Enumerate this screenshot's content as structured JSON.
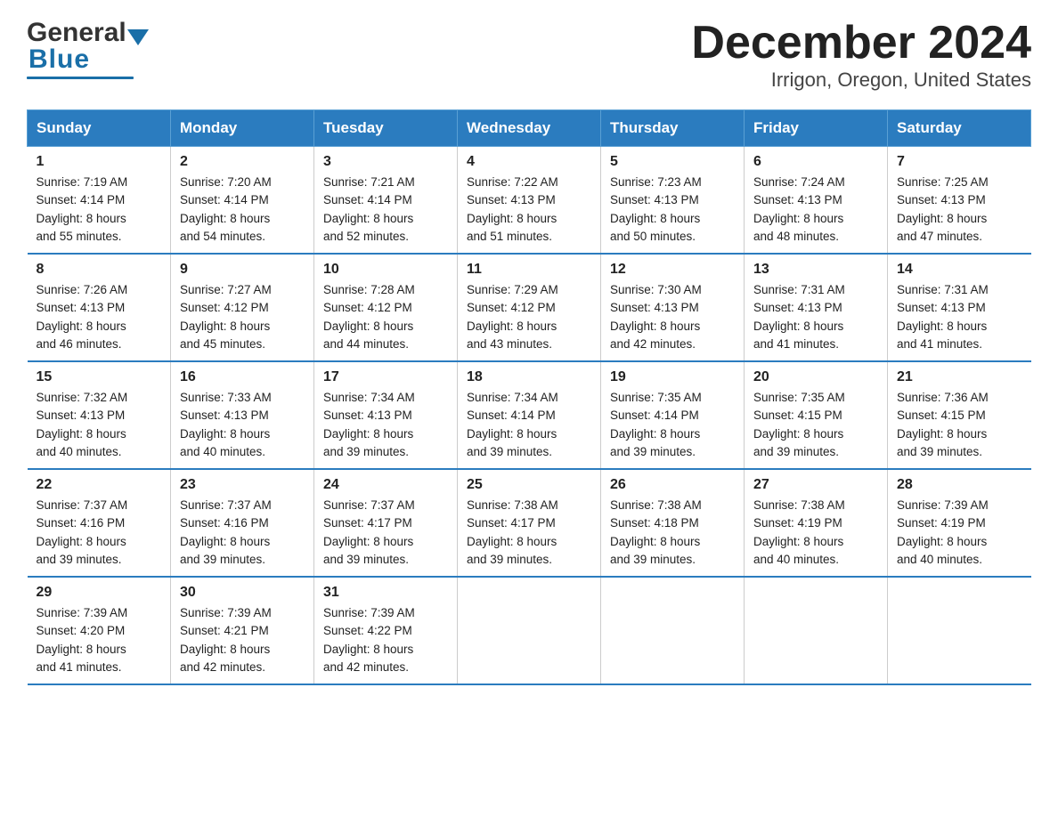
{
  "header": {
    "title": "December 2024",
    "subtitle": "Irrigon, Oregon, United States"
  },
  "logo": {
    "general": "General",
    "blue": "Blue"
  },
  "days_of_week": [
    "Sunday",
    "Monday",
    "Tuesday",
    "Wednesday",
    "Thursday",
    "Friday",
    "Saturday"
  ],
  "weeks": [
    [
      {
        "num": "1",
        "sunrise": "7:19 AM",
        "sunset": "4:14 PM",
        "daylight": "8 hours and 55 minutes."
      },
      {
        "num": "2",
        "sunrise": "7:20 AM",
        "sunset": "4:14 PM",
        "daylight": "8 hours and 54 minutes."
      },
      {
        "num": "3",
        "sunrise": "7:21 AM",
        "sunset": "4:14 PM",
        "daylight": "8 hours and 52 minutes."
      },
      {
        "num": "4",
        "sunrise": "7:22 AM",
        "sunset": "4:13 PM",
        "daylight": "8 hours and 51 minutes."
      },
      {
        "num": "5",
        "sunrise": "7:23 AM",
        "sunset": "4:13 PM",
        "daylight": "8 hours and 50 minutes."
      },
      {
        "num": "6",
        "sunrise": "7:24 AM",
        "sunset": "4:13 PM",
        "daylight": "8 hours and 48 minutes."
      },
      {
        "num": "7",
        "sunrise": "7:25 AM",
        "sunset": "4:13 PM",
        "daylight": "8 hours and 47 minutes."
      }
    ],
    [
      {
        "num": "8",
        "sunrise": "7:26 AM",
        "sunset": "4:13 PM",
        "daylight": "8 hours and 46 minutes."
      },
      {
        "num": "9",
        "sunrise": "7:27 AM",
        "sunset": "4:12 PM",
        "daylight": "8 hours and 45 minutes."
      },
      {
        "num": "10",
        "sunrise": "7:28 AM",
        "sunset": "4:12 PM",
        "daylight": "8 hours and 44 minutes."
      },
      {
        "num": "11",
        "sunrise": "7:29 AM",
        "sunset": "4:12 PM",
        "daylight": "8 hours and 43 minutes."
      },
      {
        "num": "12",
        "sunrise": "7:30 AM",
        "sunset": "4:13 PM",
        "daylight": "8 hours and 42 minutes."
      },
      {
        "num": "13",
        "sunrise": "7:31 AM",
        "sunset": "4:13 PM",
        "daylight": "8 hours and 41 minutes."
      },
      {
        "num": "14",
        "sunrise": "7:31 AM",
        "sunset": "4:13 PM",
        "daylight": "8 hours and 41 minutes."
      }
    ],
    [
      {
        "num": "15",
        "sunrise": "7:32 AM",
        "sunset": "4:13 PM",
        "daylight": "8 hours and 40 minutes."
      },
      {
        "num": "16",
        "sunrise": "7:33 AM",
        "sunset": "4:13 PM",
        "daylight": "8 hours and 40 minutes."
      },
      {
        "num": "17",
        "sunrise": "7:34 AM",
        "sunset": "4:13 PM",
        "daylight": "8 hours and 39 minutes."
      },
      {
        "num": "18",
        "sunrise": "7:34 AM",
        "sunset": "4:14 PM",
        "daylight": "8 hours and 39 minutes."
      },
      {
        "num": "19",
        "sunrise": "7:35 AM",
        "sunset": "4:14 PM",
        "daylight": "8 hours and 39 minutes."
      },
      {
        "num": "20",
        "sunrise": "7:35 AM",
        "sunset": "4:15 PM",
        "daylight": "8 hours and 39 minutes."
      },
      {
        "num": "21",
        "sunrise": "7:36 AM",
        "sunset": "4:15 PM",
        "daylight": "8 hours and 39 minutes."
      }
    ],
    [
      {
        "num": "22",
        "sunrise": "7:37 AM",
        "sunset": "4:16 PM",
        "daylight": "8 hours and 39 minutes."
      },
      {
        "num": "23",
        "sunrise": "7:37 AM",
        "sunset": "4:16 PM",
        "daylight": "8 hours and 39 minutes."
      },
      {
        "num": "24",
        "sunrise": "7:37 AM",
        "sunset": "4:17 PM",
        "daylight": "8 hours and 39 minutes."
      },
      {
        "num": "25",
        "sunrise": "7:38 AM",
        "sunset": "4:17 PM",
        "daylight": "8 hours and 39 minutes."
      },
      {
        "num": "26",
        "sunrise": "7:38 AM",
        "sunset": "4:18 PM",
        "daylight": "8 hours and 39 minutes."
      },
      {
        "num": "27",
        "sunrise": "7:38 AM",
        "sunset": "4:19 PM",
        "daylight": "8 hours and 40 minutes."
      },
      {
        "num": "28",
        "sunrise": "7:39 AM",
        "sunset": "4:19 PM",
        "daylight": "8 hours and 40 minutes."
      }
    ],
    [
      {
        "num": "29",
        "sunrise": "7:39 AM",
        "sunset": "4:20 PM",
        "daylight": "8 hours and 41 minutes."
      },
      {
        "num": "30",
        "sunrise": "7:39 AM",
        "sunset": "4:21 PM",
        "daylight": "8 hours and 42 minutes."
      },
      {
        "num": "31",
        "sunrise": "7:39 AM",
        "sunset": "4:22 PM",
        "daylight": "8 hours and 42 minutes."
      },
      null,
      null,
      null,
      null
    ]
  ],
  "labels": {
    "sunrise": "Sunrise:",
    "sunset": "Sunset:",
    "daylight": "Daylight:"
  }
}
